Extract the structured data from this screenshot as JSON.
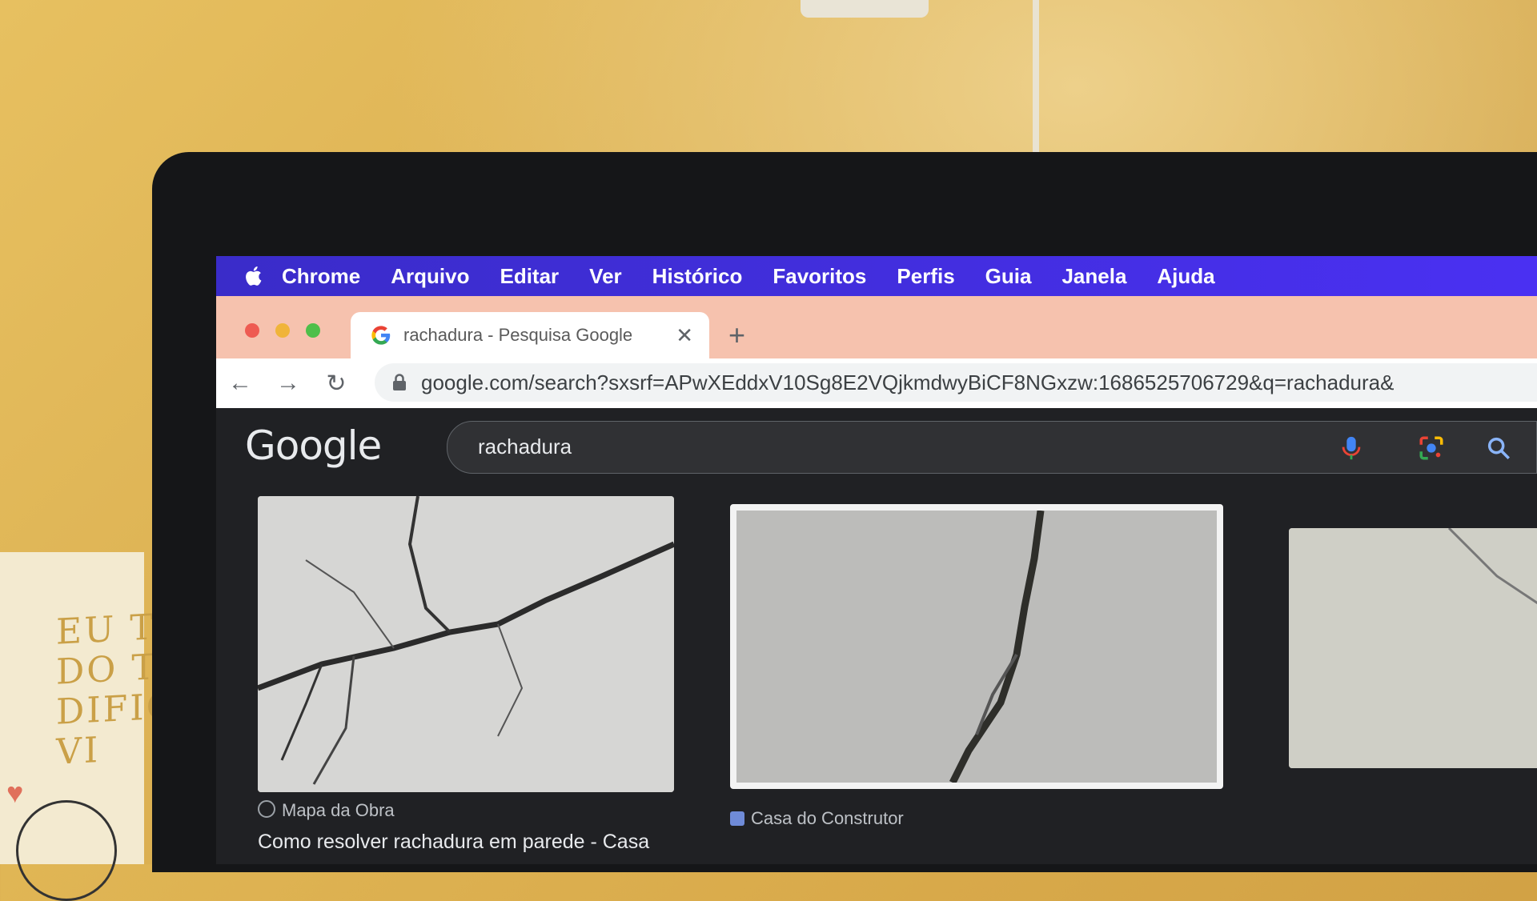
{
  "menubar": {
    "items": [
      "Chrome",
      "Arquivo",
      "Editar",
      "Ver",
      "Histórico",
      "Favoritos",
      "Perfis",
      "Guia",
      "Janela",
      "Ajuda"
    ]
  },
  "tab": {
    "title": "rachadura - Pesquisa Google",
    "close": "✕",
    "new_tab": "+"
  },
  "toolbar": {
    "back": "←",
    "forward": "→",
    "reload": "↻",
    "url": "google.com/search?sxsrf=APwXEddxV10Sg8E2VQjkmdwyBiCF8NGxzw:1686525706729&q=rachadura&"
  },
  "google": {
    "logo": "Google",
    "query": "rachadura"
  },
  "results": [
    {
      "source": "Mapa da Obra",
      "title": "Como resolver rachadura em parede - Casa"
    },
    {
      "source": "Casa do Construtor",
      "title": ""
    }
  ],
  "card": {
    "text": "EU TE\nDO TAM\nDIFICUL\nVI"
  },
  "colors": {
    "menubar": "#4a30f2",
    "tabstrip": "#f6c2ae",
    "google_bg": "#202124"
  }
}
